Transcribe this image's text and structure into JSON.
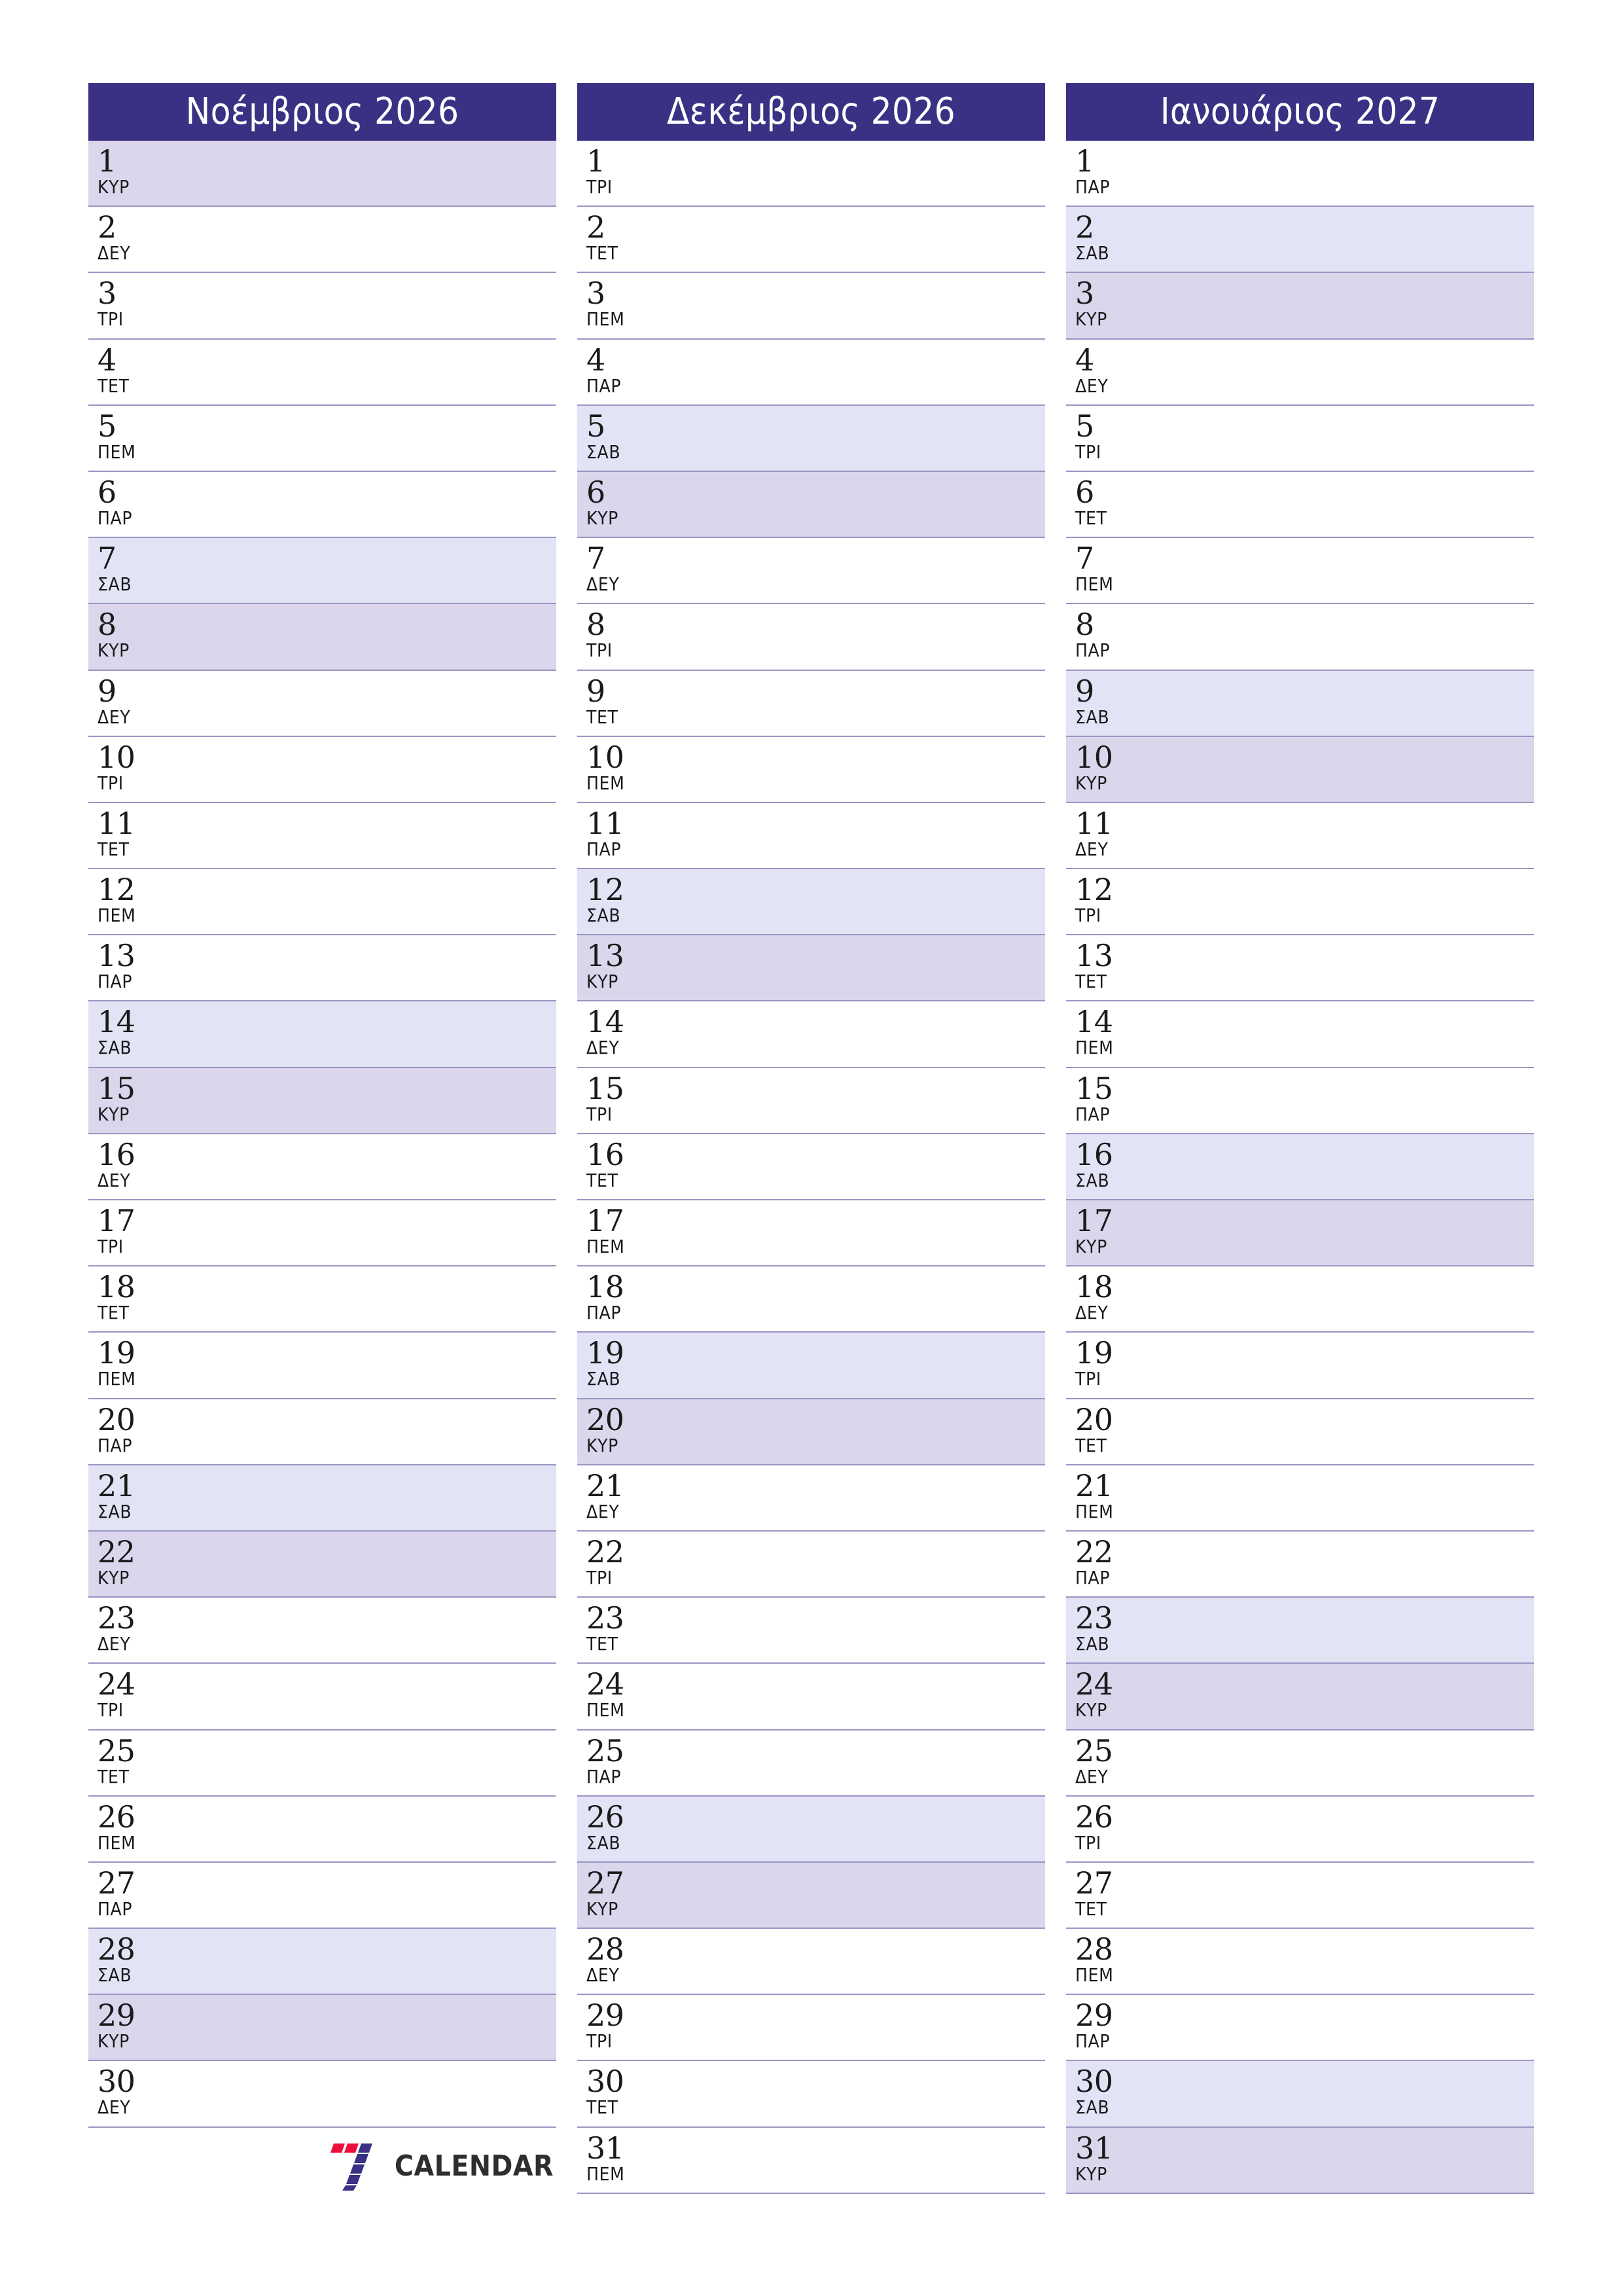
{
  "page": {
    "brand_name": "CALENDAR",
    "logo_icon": "seven-calendar-logo-icon",
    "colors": {
      "header_bg": "#3a3185",
      "header_text": "#ffffff",
      "saturday_bg": "#e3e3f6",
      "sunday_bg": "#dbd6ec",
      "row_border": "#9a95c4",
      "logo_red": "#ec0d3c",
      "logo_blue": "#3a3185",
      "logo_text": "#2e2e2e",
      "page_bg": "#ffffff",
      "day_text": "#1a1a1a"
    }
  },
  "weekday_names": {
    "mon": "ΔΕΥ",
    "tue": "ΤΡΙ",
    "wed": "ΤΕΤ",
    "thu": "ΠΕΜ",
    "fri": "ΠΑΡ",
    "sat": "ΣΑΒ",
    "sun": "ΚΥΡ"
  },
  "months": [
    {
      "title": "Νοέμβριος 2026",
      "month_name": "Νοέμβριος",
      "year": "2026",
      "days": [
        {
          "n": "1",
          "wd": "ΚΥΡ",
          "type": "sun"
        },
        {
          "n": "2",
          "wd": "ΔΕΥ",
          "type": "weekday"
        },
        {
          "n": "3",
          "wd": "ΤΡΙ",
          "type": "weekday"
        },
        {
          "n": "4",
          "wd": "ΤΕΤ",
          "type": "weekday"
        },
        {
          "n": "5",
          "wd": "ΠΕΜ",
          "type": "weekday"
        },
        {
          "n": "6",
          "wd": "ΠΑΡ",
          "type": "weekday"
        },
        {
          "n": "7",
          "wd": "ΣΑΒ",
          "type": "sat"
        },
        {
          "n": "8",
          "wd": "ΚΥΡ",
          "type": "sun"
        },
        {
          "n": "9",
          "wd": "ΔΕΥ",
          "type": "weekday"
        },
        {
          "n": "10",
          "wd": "ΤΡΙ",
          "type": "weekday"
        },
        {
          "n": "11",
          "wd": "ΤΕΤ",
          "type": "weekday"
        },
        {
          "n": "12",
          "wd": "ΠΕΜ",
          "type": "weekday"
        },
        {
          "n": "13",
          "wd": "ΠΑΡ",
          "type": "weekday"
        },
        {
          "n": "14",
          "wd": "ΣΑΒ",
          "type": "sat"
        },
        {
          "n": "15",
          "wd": "ΚΥΡ",
          "type": "sun"
        },
        {
          "n": "16",
          "wd": "ΔΕΥ",
          "type": "weekday"
        },
        {
          "n": "17",
          "wd": "ΤΡΙ",
          "type": "weekday"
        },
        {
          "n": "18",
          "wd": "ΤΕΤ",
          "type": "weekday"
        },
        {
          "n": "19",
          "wd": "ΠΕΜ",
          "type": "weekday"
        },
        {
          "n": "20",
          "wd": "ΠΑΡ",
          "type": "weekday"
        },
        {
          "n": "21",
          "wd": "ΣΑΒ",
          "type": "sat"
        },
        {
          "n": "22",
          "wd": "ΚΥΡ",
          "type": "sun"
        },
        {
          "n": "23",
          "wd": "ΔΕΥ",
          "type": "weekday"
        },
        {
          "n": "24",
          "wd": "ΤΡΙ",
          "type": "weekday"
        },
        {
          "n": "25",
          "wd": "ΤΕΤ",
          "type": "weekday"
        },
        {
          "n": "26",
          "wd": "ΠΕΜ",
          "type": "weekday"
        },
        {
          "n": "27",
          "wd": "ΠΑΡ",
          "type": "weekday"
        },
        {
          "n": "28",
          "wd": "ΣΑΒ",
          "type": "sat"
        },
        {
          "n": "29",
          "wd": "ΚΥΡ",
          "type": "sun"
        },
        {
          "n": "30",
          "wd": "ΔΕΥ",
          "type": "weekday"
        }
      ]
    },
    {
      "title": "Δεκέμβριος 2026",
      "month_name": "Δεκέμβριος",
      "year": "2026",
      "days": [
        {
          "n": "1",
          "wd": "ΤΡΙ",
          "type": "weekday"
        },
        {
          "n": "2",
          "wd": "ΤΕΤ",
          "type": "weekday"
        },
        {
          "n": "3",
          "wd": "ΠΕΜ",
          "type": "weekday"
        },
        {
          "n": "4",
          "wd": "ΠΑΡ",
          "type": "weekday"
        },
        {
          "n": "5",
          "wd": "ΣΑΒ",
          "type": "sat"
        },
        {
          "n": "6",
          "wd": "ΚΥΡ",
          "type": "sun"
        },
        {
          "n": "7",
          "wd": "ΔΕΥ",
          "type": "weekday"
        },
        {
          "n": "8",
          "wd": "ΤΡΙ",
          "type": "weekday"
        },
        {
          "n": "9",
          "wd": "ΤΕΤ",
          "type": "weekday"
        },
        {
          "n": "10",
          "wd": "ΠΕΜ",
          "type": "weekday"
        },
        {
          "n": "11",
          "wd": "ΠΑΡ",
          "type": "weekday"
        },
        {
          "n": "12",
          "wd": "ΣΑΒ",
          "type": "sat"
        },
        {
          "n": "13",
          "wd": "ΚΥΡ",
          "type": "sun"
        },
        {
          "n": "14",
          "wd": "ΔΕΥ",
          "type": "weekday"
        },
        {
          "n": "15",
          "wd": "ΤΡΙ",
          "type": "weekday"
        },
        {
          "n": "16",
          "wd": "ΤΕΤ",
          "type": "weekday"
        },
        {
          "n": "17",
          "wd": "ΠΕΜ",
          "type": "weekday"
        },
        {
          "n": "18",
          "wd": "ΠΑΡ",
          "type": "weekday"
        },
        {
          "n": "19",
          "wd": "ΣΑΒ",
          "type": "sat"
        },
        {
          "n": "20",
          "wd": "ΚΥΡ",
          "type": "sun"
        },
        {
          "n": "21",
          "wd": "ΔΕΥ",
          "type": "weekday"
        },
        {
          "n": "22",
          "wd": "ΤΡΙ",
          "type": "weekday"
        },
        {
          "n": "23",
          "wd": "ΤΕΤ",
          "type": "weekday"
        },
        {
          "n": "24",
          "wd": "ΠΕΜ",
          "type": "weekday"
        },
        {
          "n": "25",
          "wd": "ΠΑΡ",
          "type": "weekday"
        },
        {
          "n": "26",
          "wd": "ΣΑΒ",
          "type": "sat"
        },
        {
          "n": "27",
          "wd": "ΚΥΡ",
          "type": "sun"
        },
        {
          "n": "28",
          "wd": "ΔΕΥ",
          "type": "weekday"
        },
        {
          "n": "29",
          "wd": "ΤΡΙ",
          "type": "weekday"
        },
        {
          "n": "30",
          "wd": "ΤΕΤ",
          "type": "weekday"
        },
        {
          "n": "31",
          "wd": "ΠΕΜ",
          "type": "weekday"
        }
      ]
    },
    {
      "title": "Ιανουάριος 2027",
      "month_name": "Ιανουάριος",
      "year": "2027",
      "days": [
        {
          "n": "1",
          "wd": "ΠΑΡ",
          "type": "weekday"
        },
        {
          "n": "2",
          "wd": "ΣΑΒ",
          "type": "sat"
        },
        {
          "n": "3",
          "wd": "ΚΥΡ",
          "type": "sun"
        },
        {
          "n": "4",
          "wd": "ΔΕΥ",
          "type": "weekday"
        },
        {
          "n": "5",
          "wd": "ΤΡΙ",
          "type": "weekday"
        },
        {
          "n": "6",
          "wd": "ΤΕΤ",
          "type": "weekday"
        },
        {
          "n": "7",
          "wd": "ΠΕΜ",
          "type": "weekday"
        },
        {
          "n": "8",
          "wd": "ΠΑΡ",
          "type": "weekday"
        },
        {
          "n": "9",
          "wd": "ΣΑΒ",
          "type": "sat"
        },
        {
          "n": "10",
          "wd": "ΚΥΡ",
          "type": "sun"
        },
        {
          "n": "11",
          "wd": "ΔΕΥ",
          "type": "weekday"
        },
        {
          "n": "12",
          "wd": "ΤΡΙ",
          "type": "weekday"
        },
        {
          "n": "13",
          "wd": "ΤΕΤ",
          "type": "weekday"
        },
        {
          "n": "14",
          "wd": "ΠΕΜ",
          "type": "weekday"
        },
        {
          "n": "15",
          "wd": "ΠΑΡ",
          "type": "weekday"
        },
        {
          "n": "16",
          "wd": "ΣΑΒ",
          "type": "sat"
        },
        {
          "n": "17",
          "wd": "ΚΥΡ",
          "type": "sun"
        },
        {
          "n": "18",
          "wd": "ΔΕΥ",
          "type": "weekday"
        },
        {
          "n": "19",
          "wd": "ΤΡΙ",
          "type": "weekday"
        },
        {
          "n": "20",
          "wd": "ΤΕΤ",
          "type": "weekday"
        },
        {
          "n": "21",
          "wd": "ΠΕΜ",
          "type": "weekday"
        },
        {
          "n": "22",
          "wd": "ΠΑΡ",
          "type": "weekday"
        },
        {
          "n": "23",
          "wd": "ΣΑΒ",
          "type": "sat"
        },
        {
          "n": "24",
          "wd": "ΚΥΡ",
          "type": "sun"
        },
        {
          "n": "25",
          "wd": "ΔΕΥ",
          "type": "weekday"
        },
        {
          "n": "26",
          "wd": "ΤΡΙ",
          "type": "weekday"
        },
        {
          "n": "27",
          "wd": "ΤΕΤ",
          "type": "weekday"
        },
        {
          "n": "28",
          "wd": "ΠΕΜ",
          "type": "weekday"
        },
        {
          "n": "29",
          "wd": "ΠΑΡ",
          "type": "weekday"
        },
        {
          "n": "30",
          "wd": "ΣΑΒ",
          "type": "sat"
        },
        {
          "n": "31",
          "wd": "ΚΥΡ",
          "type": "sun"
        }
      ]
    }
  ]
}
